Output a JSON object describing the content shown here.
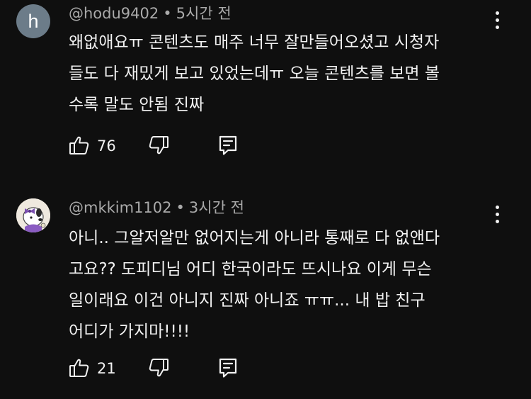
{
  "comments": [
    {
      "avatar_letter": "h",
      "handle": "@hodu9402",
      "separator": "•",
      "time": "5시간 전",
      "text": "왜없애요ㅠ 콘텐츠도 매주 너무 잘만들어오셨고 시청자\n들도 다 재밌게 보고 있었는데ㅠ 오늘 콘텐츠를 보면 볼\n수록 말도 안됨 진짜",
      "likes": "76",
      "avatar_color": "#6c7c89"
    },
    {
      "handle": "@mkkim1102",
      "separator": "•",
      "time": "3시간 전",
      "text": "아니.. 그알저알만 없어지는게 아니라 통째로 다 없앤다\n고요?? 도피디님 어디 한국이라도 뜨시나요 이게 무슨\n일이래요 이건 아니지 진짜 아니죠 ㅠㅠ... 내 밥 친구\n어디가 가지마!!!!",
      "likes": "21"
    }
  ],
  "icons": {
    "like": "thumb-up-icon",
    "dislike": "thumb-down-icon",
    "reply": "comment-reply-icon",
    "more": "more-vertical-icon"
  },
  "colors": {
    "background": "#0f0f0f",
    "text": "#f1f1f1",
    "secondary_text": "#aaaaaa"
  }
}
